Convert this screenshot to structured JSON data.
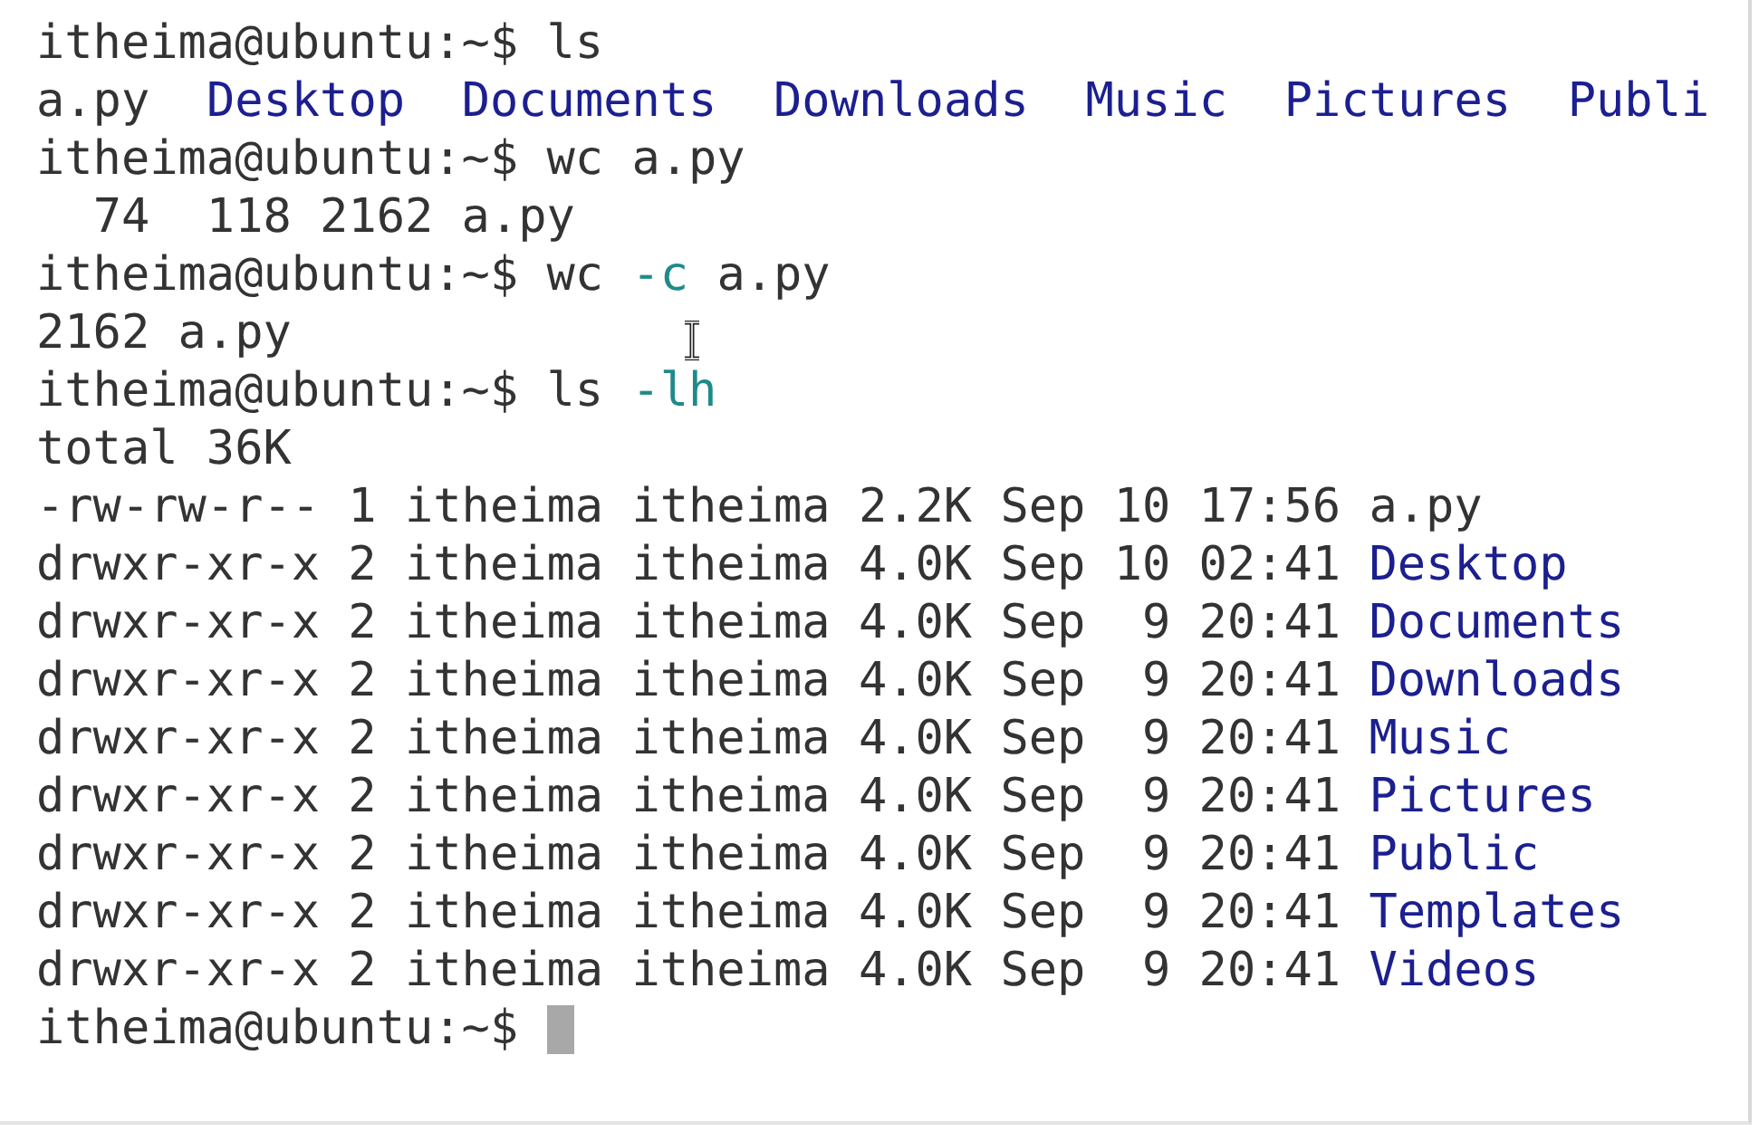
{
  "lines": [
    {
      "segments": [
        {
          "kind": "prompt",
          "text": "itheima@ubuntu:~$"
        },
        {
          "kind": "plain",
          "text": " ls"
        }
      ]
    },
    {
      "segments": [
        {
          "kind": "plain",
          "text": "a.py"
        },
        {
          "kind": "dir",
          "text": "  Desktop"
        },
        {
          "kind": "dir",
          "text": "  Documents"
        },
        {
          "kind": "dir",
          "text": "  Downloads"
        },
        {
          "kind": "dir",
          "text": "  Music"
        },
        {
          "kind": "dir",
          "text": "  Pictures"
        },
        {
          "kind": "dir",
          "text": "  Publi"
        }
      ]
    },
    {
      "segments": [
        {
          "kind": "prompt",
          "text": "itheima@ubuntu:~$"
        },
        {
          "kind": "plain",
          "text": " wc a.py"
        }
      ]
    },
    {
      "segments": [
        {
          "kind": "plain",
          "text": "  74  118 2162 a.py"
        }
      ]
    },
    {
      "segments": [
        {
          "kind": "prompt",
          "text": "itheima@ubuntu:~$"
        },
        {
          "kind": "plain",
          "text": " wc "
        },
        {
          "kind": "option",
          "text": "-c"
        },
        {
          "kind": "plain",
          "text": " a.py"
        }
      ]
    },
    {
      "segments": [
        {
          "kind": "plain",
          "text": "2162 a.py"
        }
      ]
    },
    {
      "segments": [
        {
          "kind": "prompt",
          "text": "itheima@ubuntu:~$"
        },
        {
          "kind": "plain",
          "text": " ls "
        },
        {
          "kind": "option",
          "text": "-lh"
        }
      ]
    },
    {
      "segments": [
        {
          "kind": "plain",
          "text": "total 36K"
        }
      ]
    },
    {
      "segments": [
        {
          "kind": "plain",
          "text": "-rw-rw-r-- 1 itheima itheima 2.2K Sep 10 17:56 a.py"
        }
      ]
    },
    {
      "segments": [
        {
          "kind": "plain",
          "text": "drwxr-xr-x 2 itheima itheima 4.0K Sep 10 02:41"
        },
        {
          "kind": "dir",
          "text": " Desktop"
        }
      ]
    },
    {
      "segments": [
        {
          "kind": "plain",
          "text": "drwxr-xr-x 2 itheima itheima 4.0K Sep  9 20:41"
        },
        {
          "kind": "dir",
          "text": " Documents"
        }
      ]
    },
    {
      "segments": [
        {
          "kind": "plain",
          "text": "drwxr-xr-x 2 itheima itheima 4.0K Sep  9 20:41"
        },
        {
          "kind": "dir",
          "text": " Downloads"
        }
      ]
    },
    {
      "segments": [
        {
          "kind": "plain",
          "text": "drwxr-xr-x 2 itheima itheima 4.0K Sep  9 20:41"
        },
        {
          "kind": "dir",
          "text": " Music"
        }
      ]
    },
    {
      "segments": [
        {
          "kind": "plain",
          "text": "drwxr-xr-x 2 itheima itheima 4.0K Sep  9 20:41"
        },
        {
          "kind": "dir",
          "text": " Pictures"
        }
      ]
    },
    {
      "segments": [
        {
          "kind": "plain",
          "text": "drwxr-xr-x 2 itheima itheima 4.0K Sep  9 20:41"
        },
        {
          "kind": "dir",
          "text": " Public"
        }
      ]
    },
    {
      "segments": [
        {
          "kind": "plain",
          "text": "drwxr-xr-x 2 itheima itheima 4.0K Sep  9 20:41"
        },
        {
          "kind": "dir",
          "text": " Templates"
        }
      ]
    },
    {
      "segments": [
        {
          "kind": "plain",
          "text": "drwxr-xr-x 2 itheima itheima 4.0K Sep  9 20:41"
        },
        {
          "kind": "dir",
          "text": " Videos"
        }
      ]
    },
    {
      "segments": [
        {
          "kind": "prompt",
          "text": "itheima@ubuntu:~$"
        }
      ]
    }
  ],
  "cursor": {
    "visible": true
  }
}
